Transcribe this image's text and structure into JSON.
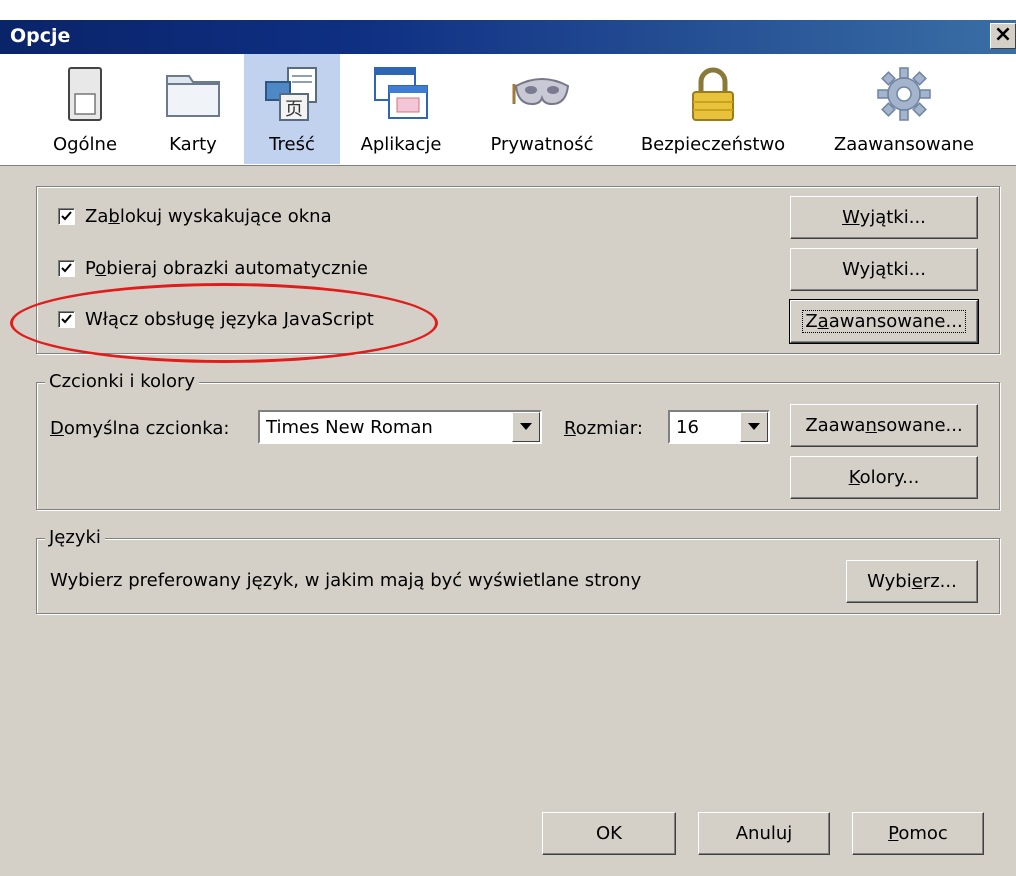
{
  "window": {
    "title": "Opcje",
    "close_glyph": "×"
  },
  "toolbar": {
    "items": [
      {
        "label": "Ogólne",
        "icon": "switch-icon"
      },
      {
        "label": "Karty",
        "icon": "tabs-folder-icon"
      },
      {
        "label": "Treść",
        "icon": "content-icon",
        "active": true
      },
      {
        "label": "Aplikacje",
        "icon": "applications-icon"
      },
      {
        "label": "Prywatność",
        "icon": "mask-icon"
      },
      {
        "label": "Bezpieczeństwo",
        "icon": "padlock-icon"
      },
      {
        "label": "Zaawansowane",
        "icon": "gear-icon"
      }
    ]
  },
  "content": {
    "checkboxes": [
      {
        "pre": "Za",
        "u": "b",
        "post": "lokuj wyskakujące okna",
        "checked": true
      },
      {
        "pre": "P",
        "u": "o",
        "post": "bieraj obrazki automatycznie",
        "checked": true
      },
      {
        "pre": "Włącz obsługę języka ",
        "u": "J",
        "post": "avaScript",
        "checked": true
      }
    ],
    "buttons": [
      {
        "pre": "",
        "u": "W",
        "post": "yjątki..."
      },
      {
        "pre": "Wy",
        "u": "j",
        "post": "ątki..."
      },
      {
        "pre": "Z",
        "u": "a",
        "post": "awansowane..."
      }
    ]
  },
  "fonts": {
    "legend": "Czcionki i kolory",
    "default_font_label_pre": "",
    "default_font_label_u": "D",
    "default_font_label_post": "omyślna czcionka:",
    "default_font_value": "Times New Roman",
    "size_label_pre": "",
    "size_label_u": "R",
    "size_label_post": "ozmiar:",
    "size_value": "16",
    "advanced_pre": "Zaawa",
    "advanced_u": "n",
    "advanced_post": "sowane...",
    "colors_pre": "",
    "colors_u": "K",
    "colors_post": "olory..."
  },
  "languages": {
    "legend": "Języki",
    "description": "Wybierz preferowany język, w jakim mają być wyświetlane strony",
    "choose_pre": "Wybi",
    "choose_u": "e",
    "choose_post": "rz..."
  },
  "footer": {
    "ok": "OK",
    "cancel": "Anuluj",
    "help_pre": "",
    "help_u": "P",
    "help_post": "omoc"
  },
  "colors": {
    "title_bar": "#0a246a",
    "dialog_face": "#d4d0c8",
    "active_tab": "#c1d2ee",
    "highlight_ellipse": "#e21b1b"
  }
}
